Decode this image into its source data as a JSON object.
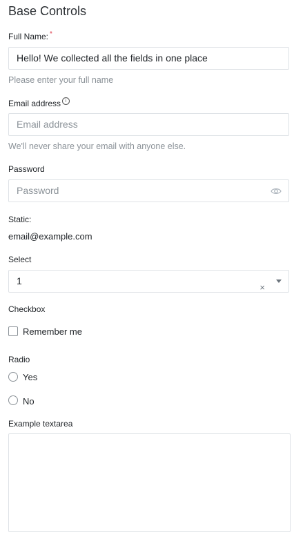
{
  "section_title": "Base Controls",
  "full_name": {
    "label": "Full Name:",
    "required_mark": "*",
    "value": "Hello! We collected all the fields in one place",
    "help": "Please enter your full name"
  },
  "email": {
    "label": "Email address",
    "info_icon": "i",
    "placeholder": "Email address",
    "help": "We'll never share your email with anyone else."
  },
  "password": {
    "label": "Password",
    "placeholder": "Password"
  },
  "static": {
    "label": "Static:",
    "value": "email@example.com"
  },
  "select": {
    "label": "Select",
    "value": "1",
    "clear": "×"
  },
  "checkbox": {
    "label": "Checkbox",
    "option": "Remember me",
    "checked": false
  },
  "radio": {
    "label": "Radio",
    "options": [
      "Yes",
      "No"
    ]
  },
  "textarea": {
    "label": "Example textarea",
    "value": ""
  }
}
